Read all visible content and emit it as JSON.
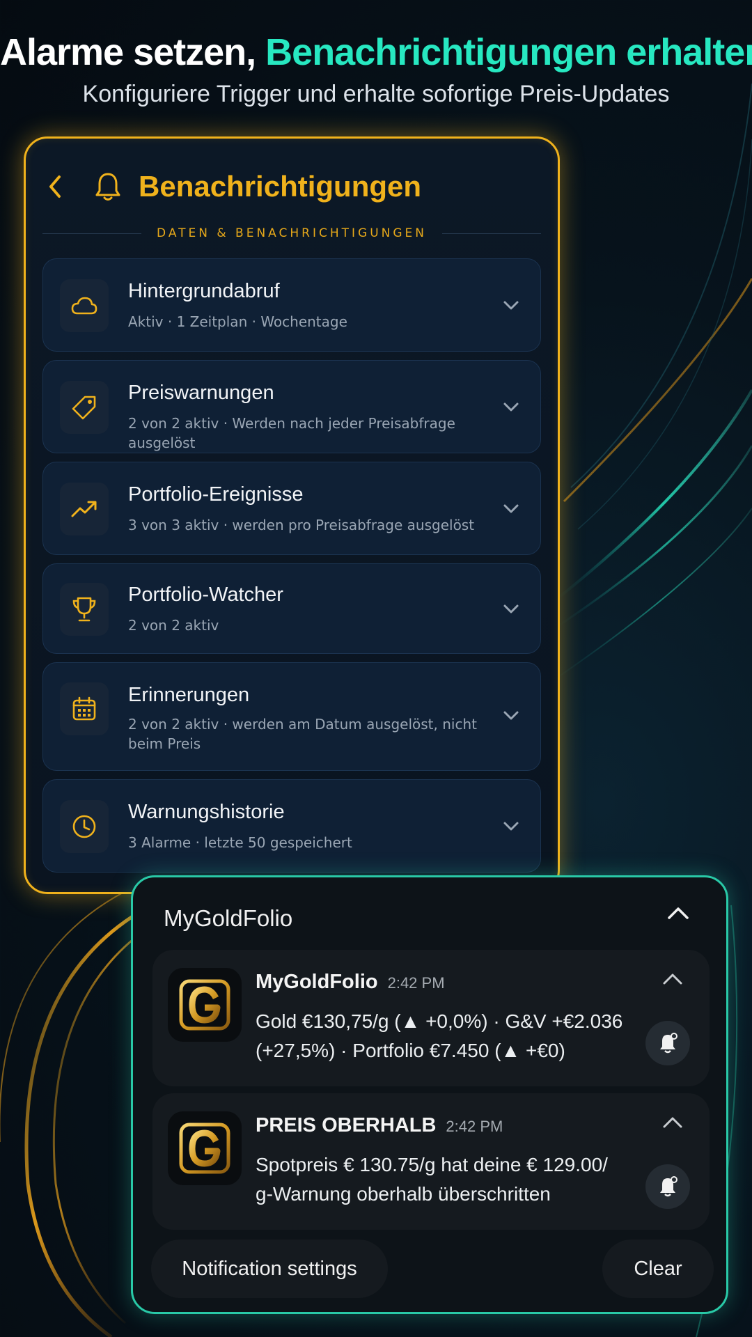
{
  "headline": {
    "title_part1": "Alarme setzen, ",
    "title_part2": "Benachrichtigungen erhalten",
    "subtitle": "Konfiguriere Trigger und erhalte sofortige Preis-Updates"
  },
  "panel": {
    "title": "Benachrichtigungen",
    "section_label": "DATEN & BENACHRICHTIGUNGEN",
    "items": [
      {
        "icon": "cloud-icon",
        "title": "Hintergrundabruf",
        "subtitle": "Aktiv · 1 Zeitplan · Wochentage"
      },
      {
        "icon": "tag-icon",
        "title": "Preiswarnungen",
        "subtitle": "2 von 2 aktiv · Werden nach jeder Preisabfrage ausgelöst"
      },
      {
        "icon": "trend-up-icon",
        "title": "Portfolio-Ereignisse",
        "subtitle": "3 von 3 aktiv · werden pro Preisabfrage ausgelöst"
      },
      {
        "icon": "trophy-icon",
        "title": "Portfolio-Watcher",
        "subtitle": "2 von 2 aktiv"
      },
      {
        "icon": "calendar-icon",
        "title": "Erinnerungen",
        "subtitle": "2 von 2 aktiv · werden am Datum ausgelöst, nicht beim Preis"
      },
      {
        "icon": "clock-icon",
        "title": "Warnungshistorie",
        "subtitle": "3 Alarme · letzte 50 gespeichert"
      }
    ]
  },
  "notifications": {
    "app_name": "MyGoldFolio",
    "cards": [
      {
        "title": "MyGoldFolio",
        "time": "2:42 PM",
        "body": "Gold €130,75/g (▲ +0,0%) · G&V +€2.036 (+27,5%) · Portfolio €7.450 (▲ +€0)"
      },
      {
        "title": "PREIS OBERHALB",
        "time": "2:42 PM",
        "body": "Spotpreis € 130.75/g hat deine € 129.00/ g-Warnung oberhalb überschritten"
      }
    ],
    "settings_label": "Notification settings",
    "clear_label": "Clear"
  },
  "colors": {
    "accent_gold": "#f0b21c",
    "accent_teal": "#27e8c1"
  }
}
